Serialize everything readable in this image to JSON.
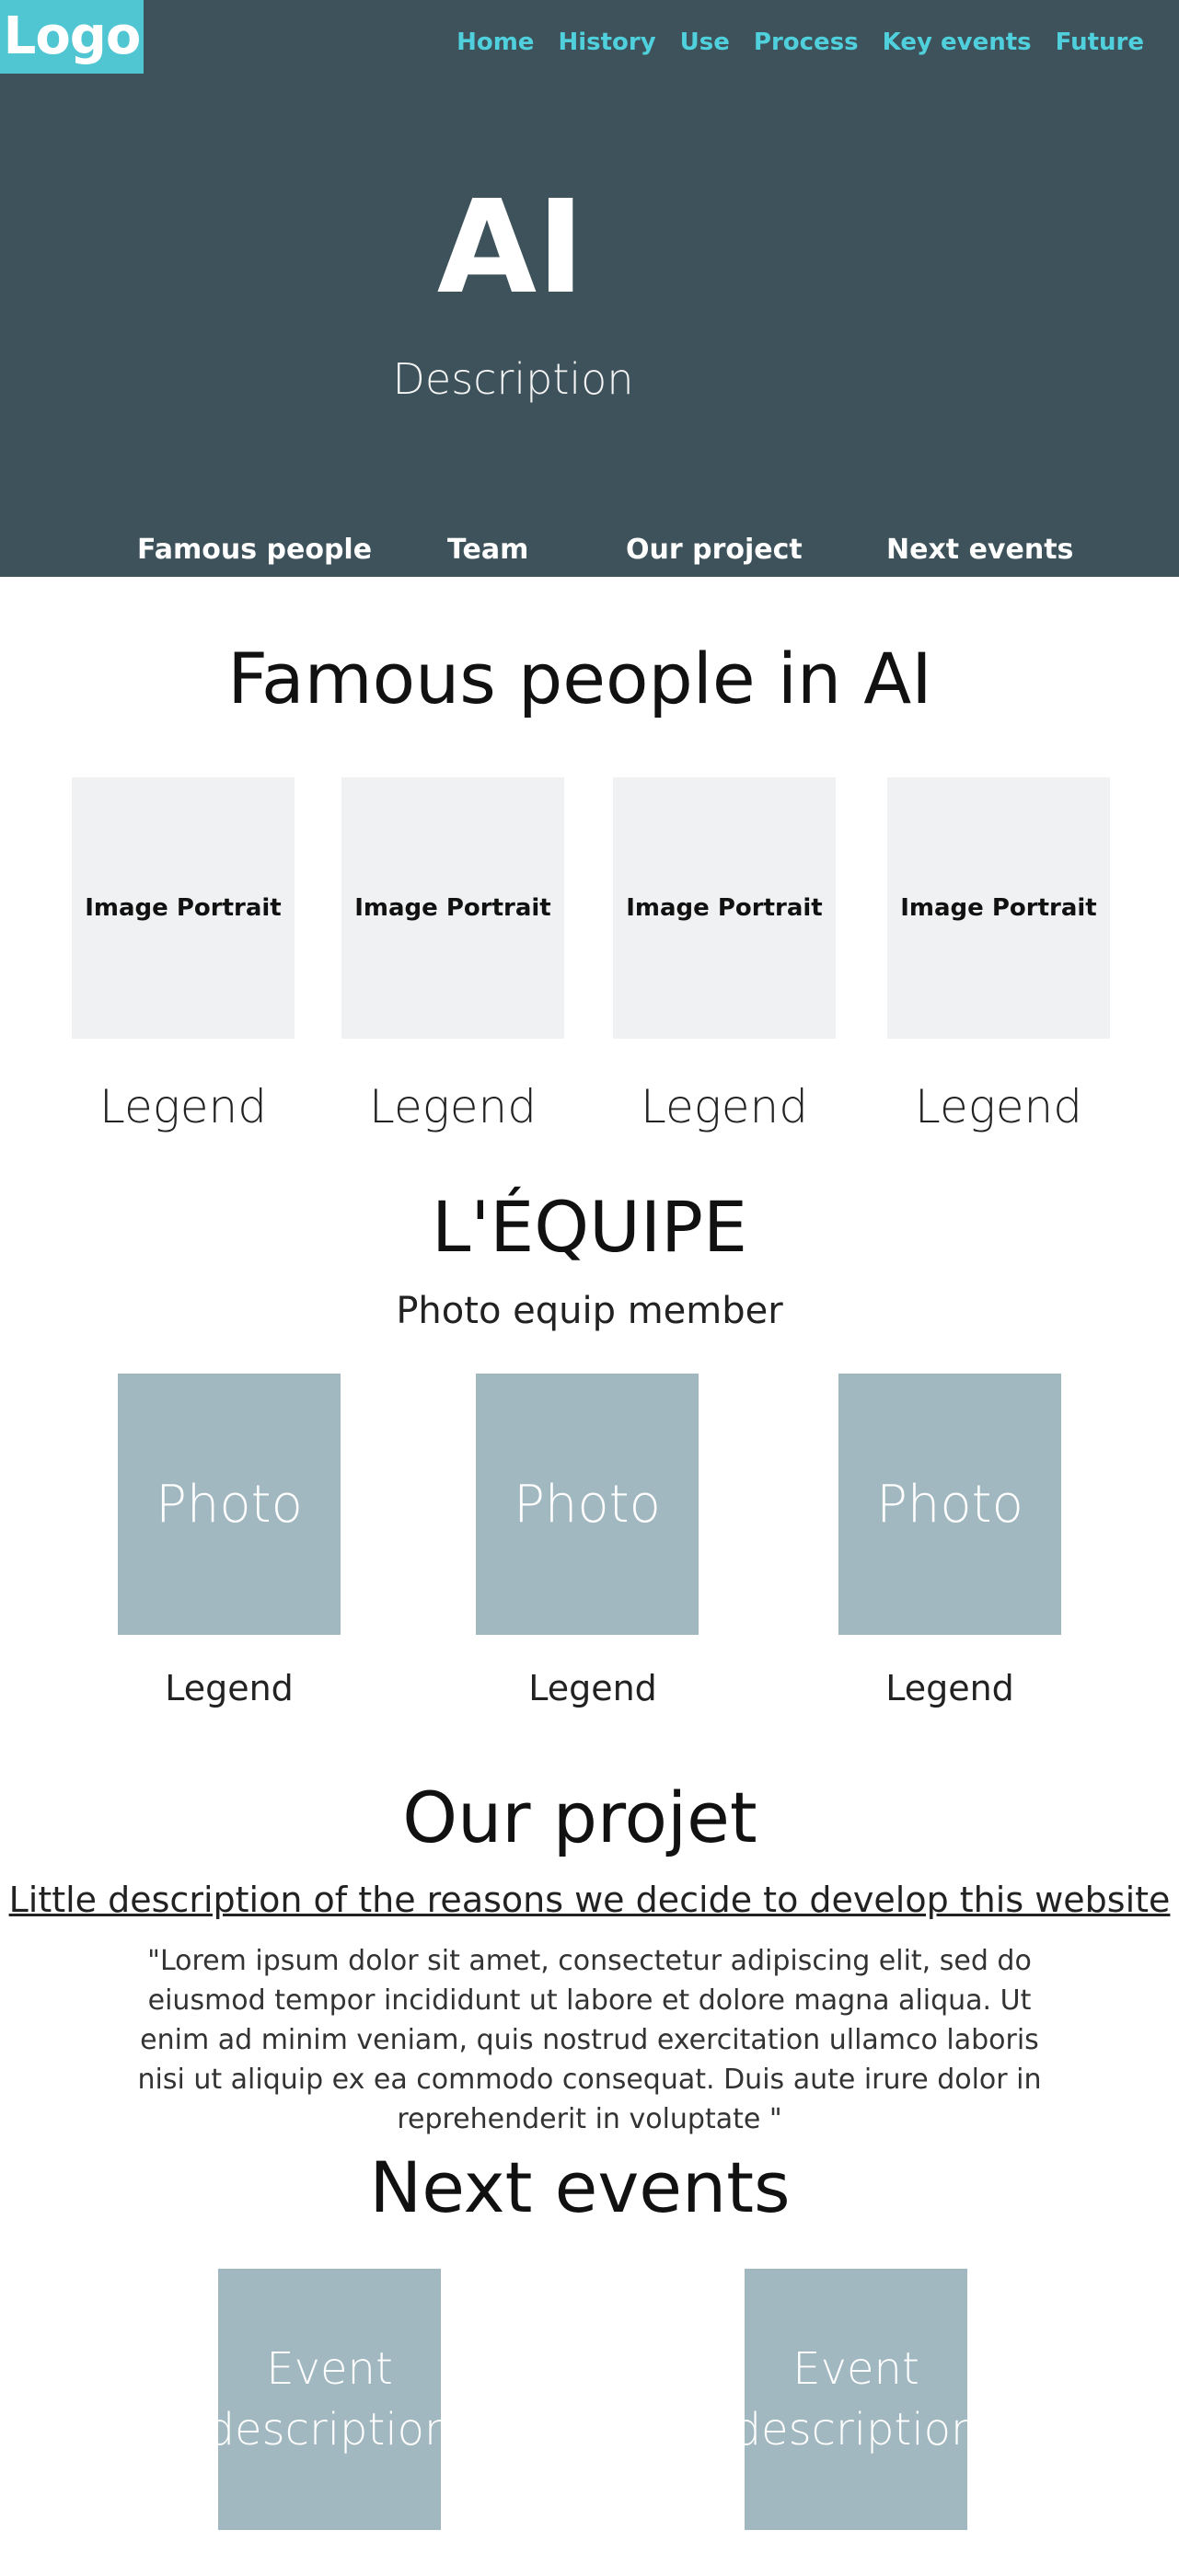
{
  "header": {
    "logo": "Logo",
    "nav": [
      "Home",
      "History",
      "Use",
      "Process",
      "Key events",
      "Future"
    ],
    "title": "AI",
    "description": "Description",
    "section_nav": [
      "Famous people",
      "Team",
      "Our project",
      "Next events"
    ],
    "background_color": "#3d525a",
    "accent_color": "#4fc6d1"
  },
  "famous": {
    "heading": "Famous people in AI",
    "cards": [
      {
        "image_label": "Image Portrait",
        "legend": "Legend"
      },
      {
        "image_label": "Image Portrait",
        "legend": "Legend"
      },
      {
        "image_label": "Image Portrait",
        "legend": "Legend"
      },
      {
        "image_label": "Image Portrait",
        "legend": "Legend"
      }
    ]
  },
  "team": {
    "heading": "L'ÉQUIPE",
    "subheading": "Photo equip member",
    "members": [
      {
        "photo_label": "Photo",
        "legend": "Legend"
      },
      {
        "photo_label": "Photo",
        "legend": "Legend"
      },
      {
        "photo_label": "Photo",
        "legend": "Legend"
      }
    ],
    "photo_color": "#a2b8c0"
  },
  "project": {
    "heading": "Our projet",
    "link_text": "Little description of the reasons we decide to develop this website",
    "body": "\"Lorem ipsum dolor sit amet, consectetur adipiscing elit, sed do eiusmod tempor incididunt ut labore et dolore magna aliqua. Ut enim ad minim veniam, quis nostrud exercitation ullamco laboris nisi ut aliquip ex ea commodo consequat. Duis aute irure dolor in reprehenderit in voluptate \""
  },
  "events": {
    "heading": "Next events",
    "items": [
      {
        "label": "Event description"
      },
      {
        "label": "Event description"
      }
    ]
  }
}
